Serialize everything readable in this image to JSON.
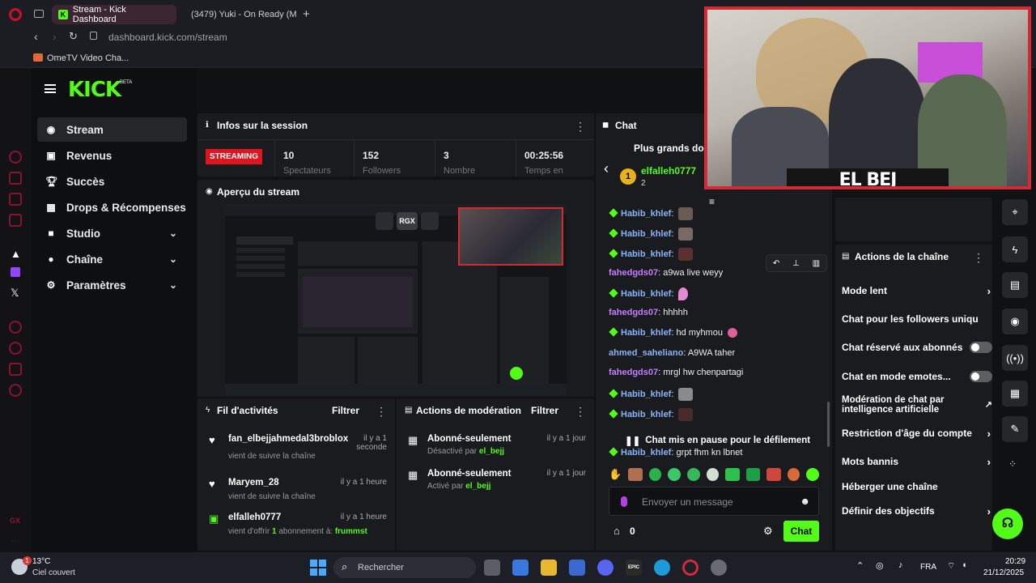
{
  "browser": {
    "tabs": [
      {
        "label": "Stream - Kick Dashboard"
      },
      {
        "label": "(3479) Yuki - On Ready (M"
      }
    ],
    "url": "dashboard.kick.com/stream",
    "bookmark": "OmeTV Video Cha..."
  },
  "kick": {
    "logo": "KICK",
    "beta": "BETA"
  },
  "sidebar": {
    "items": [
      {
        "label": "Stream",
        "icon": "broadcast-icon"
      },
      {
        "label": "Revenus",
        "icon": "wallet-icon"
      },
      {
        "label": "Succès",
        "icon": "trophy-icon"
      },
      {
        "label": "Drops & Récompenses",
        "icon": "gift-icon"
      },
      {
        "label": "Studio",
        "icon": "camera-icon"
      },
      {
        "label": "Chaîne",
        "icon": "user-icon"
      },
      {
        "label": "Paramètres",
        "icon": "gear-icon"
      }
    ]
  },
  "session": {
    "title": "Infos sur la session",
    "status": "STREAMING",
    "stats": [
      {
        "value": "10",
        "label": "Spectateurs"
      },
      {
        "value": "152",
        "label": "Followers"
      },
      {
        "value": "3",
        "label": "Nombre"
      },
      {
        "value": "00:25:56",
        "label": "Temps en"
      }
    ]
  },
  "preview": {
    "title": "Aperçu du stream",
    "rgx": "RGX"
  },
  "activity": {
    "title": "Fil d'activités",
    "filter": "Filtrer",
    "items": [
      {
        "name": "fan_elbejjahmedal3broblox",
        "sub": "vient de suivre la chaîne",
        "time": "il y a 1 seconde"
      },
      {
        "name": "Maryem_28",
        "sub": "vient de suivre la chaîne",
        "time": "il y a 1 heure"
      },
      {
        "name": "elfalleh0777",
        "sub_prefix": "vient d'offrir",
        "sub_count": "1",
        "sub_mid": "abonnement à:",
        "sub_target": "frummst",
        "time": "il y a 1 heure"
      }
    ]
  },
  "moderation": {
    "title": "Actions de modération",
    "filter": "Filtrer",
    "items": [
      {
        "name": "Abonné-seulement",
        "sub": "Désactivé par",
        "by": "el_bejj",
        "time": "il y a 1 jour"
      },
      {
        "name": "Abonné-seulement",
        "sub": "Activé par",
        "by": "el_bejj",
        "time": "il y a 1 jour"
      }
    ]
  },
  "chat": {
    "title": "Chat",
    "leaderboard": "Plus grands don",
    "top_user": "elfalleh0777",
    "top_rank": "1",
    "top_count": "2",
    "messages": [
      {
        "user": "Habib_khlef",
        "text": "",
        "badge": true,
        "emote": "#6a5b55"
      },
      {
        "user": "Habib_khlef",
        "text": "",
        "badge": true,
        "emote": "#7a6a66"
      },
      {
        "user": "Habib_khlef",
        "text": "",
        "badge": true,
        "emote": "#5a3030"
      },
      {
        "user": "fahedgds07",
        "text": "a9wa live weyy",
        "badge": false
      },
      {
        "user": "Habib_khlef",
        "text": "",
        "badge": true,
        "emote": "#e58ad6"
      },
      {
        "user": "fahedgds07",
        "text": "hhhhh",
        "badge": false
      },
      {
        "user": "Habib_khlef",
        "text": "hd myhmou",
        "badge": true,
        "emote": "#e0609a"
      },
      {
        "user": "ahmed_saheliano",
        "text": "A9WA taher",
        "badge": false
      },
      {
        "user": "fahedgds07",
        "text": "mrgl hw chenpartagi",
        "badge": false
      },
      {
        "user": "Habib_khlef",
        "text": "",
        "badge": true,
        "emote": "#8a8a8a"
      },
      {
        "user": "Habib_khlef",
        "text": "",
        "badge": true,
        "emote": "#4a2a2a"
      },
      {
        "user": "Habib_khlef",
        "text": "grpt fhm kn lbnet",
        "badge": true
      }
    ],
    "paused": "Chat mis en pause pour le défilement",
    "placeholder": "Envoyer un message",
    "points": "0",
    "send": "Chat"
  },
  "webcam": {
    "name": "EL BEJ"
  },
  "actions": {
    "title": "Actions de la chaîne",
    "items": [
      {
        "label": "Mode lent",
        "ctrl": "arrow"
      },
      {
        "label": "Chat pour les followers uniqu",
        "ctrl": "arrow"
      },
      {
        "label": "Chat réservé aux abonnés",
        "ctrl": "toggle"
      },
      {
        "label": "Chat en mode emotes...",
        "ctrl": "toggle"
      },
      {
        "label": "Modération de chat par intelligence artificielle",
        "ctrl": "ext"
      },
      {
        "label": "Restriction d'âge du compte",
        "ctrl": "arrow"
      },
      {
        "label": "Mots bannis",
        "ctrl": "arrow"
      },
      {
        "label": "Héberger une chaîne",
        "ctrl": "none"
      },
      {
        "label": "Définir des objectifs",
        "ctrl": "arrow"
      }
    ]
  },
  "taskbar": {
    "weather_temp": "13°C",
    "weather_desc": "Ciel couvert",
    "weather_badge": "1",
    "search": "Rechercher",
    "lang": "FRA",
    "time": "20:29",
    "date": "21/12/2025",
    "epic": "EPIC"
  },
  "colors": {
    "kick_green": "#53fc18",
    "streaming_red": "#e0141f",
    "webcam_border": "#d42a36"
  }
}
